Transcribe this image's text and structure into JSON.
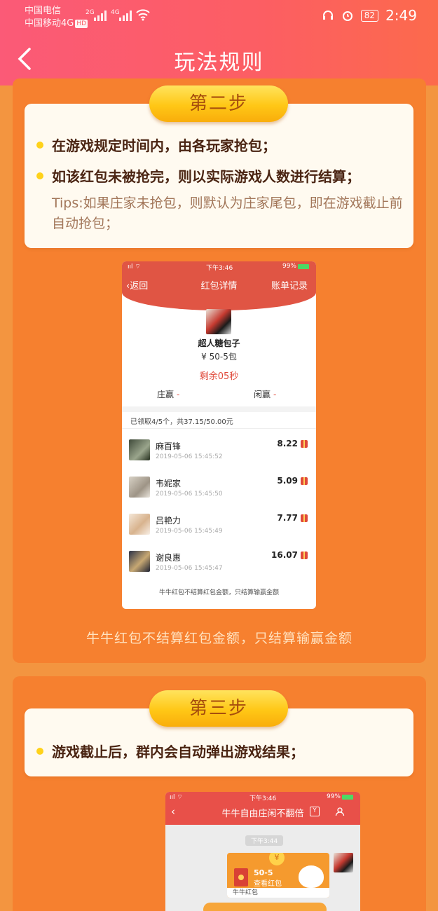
{
  "status_bar": {
    "carrier1": "中国电信",
    "carrier2": "中国移动4G",
    "hd_badge": "HD",
    "net1": "2G",
    "net2": "4G",
    "battery": "82",
    "time": "2:49"
  },
  "nav": {
    "title": "玩法规则",
    "back_icon": "chevron-left-icon"
  },
  "step2": {
    "label": "第二步",
    "rules": [
      "在游戏规定时间内，由各玩家抢包；",
      "如该红包未被抢完，则以实际游戏人数进行结算；"
    ],
    "tips": "Tips:如果庄家未抢包，则默认为庄家尾包，即在游戏截止前自动抢包；",
    "caption": "牛牛红包不结算红包金额，只结算输赢金额"
  },
  "shot1": {
    "status_time": "下午3:46",
    "battery": "99%",
    "back": "返回",
    "title": "红包详情",
    "right": "账单记录",
    "name": "超人糖包子",
    "amount": "¥ 50-5包",
    "remaining": "剩余05秒",
    "banker_win": "庄赢",
    "player_win": "闲赢",
    "dash": "-",
    "summary": "已领取4/5个，共37.15/50.00元",
    "rows": [
      {
        "name": "麻百锋",
        "time": "2019-05-06 15:45:52",
        "value": "8.22"
      },
      {
        "name": "韦妮家",
        "time": "2019-05-06 15:45:50",
        "value": "5.09"
      },
      {
        "name": "吕艳力",
        "time": "2019-05-06 15:45:49",
        "value": "7.77"
      },
      {
        "name": "谢良惠",
        "time": "2019-05-06 15:45:47",
        "value": "16.07"
      }
    ],
    "footer": "牛牛红包不结算红包金额，只结算输赢金额"
  },
  "step3": {
    "label": "第三步",
    "rules": [
      "游戏截止后，群内会自动弹出游戏结果；"
    ]
  },
  "shot2": {
    "status_time": "下午3:46",
    "battery": "99%",
    "title": "牛牛自由庄闲不翻倍",
    "icon_label": "Y",
    "chat_time": "下午3:44",
    "packet_amount": "50-5",
    "packet_action": "查看红包",
    "packet_footer": "牛牛红包",
    "coin": "¥"
  },
  "colors": {
    "header": "#fc5e63",
    "panel": "#f6802f",
    "pill": "#ffc716",
    "red": "#e0493a"
  }
}
